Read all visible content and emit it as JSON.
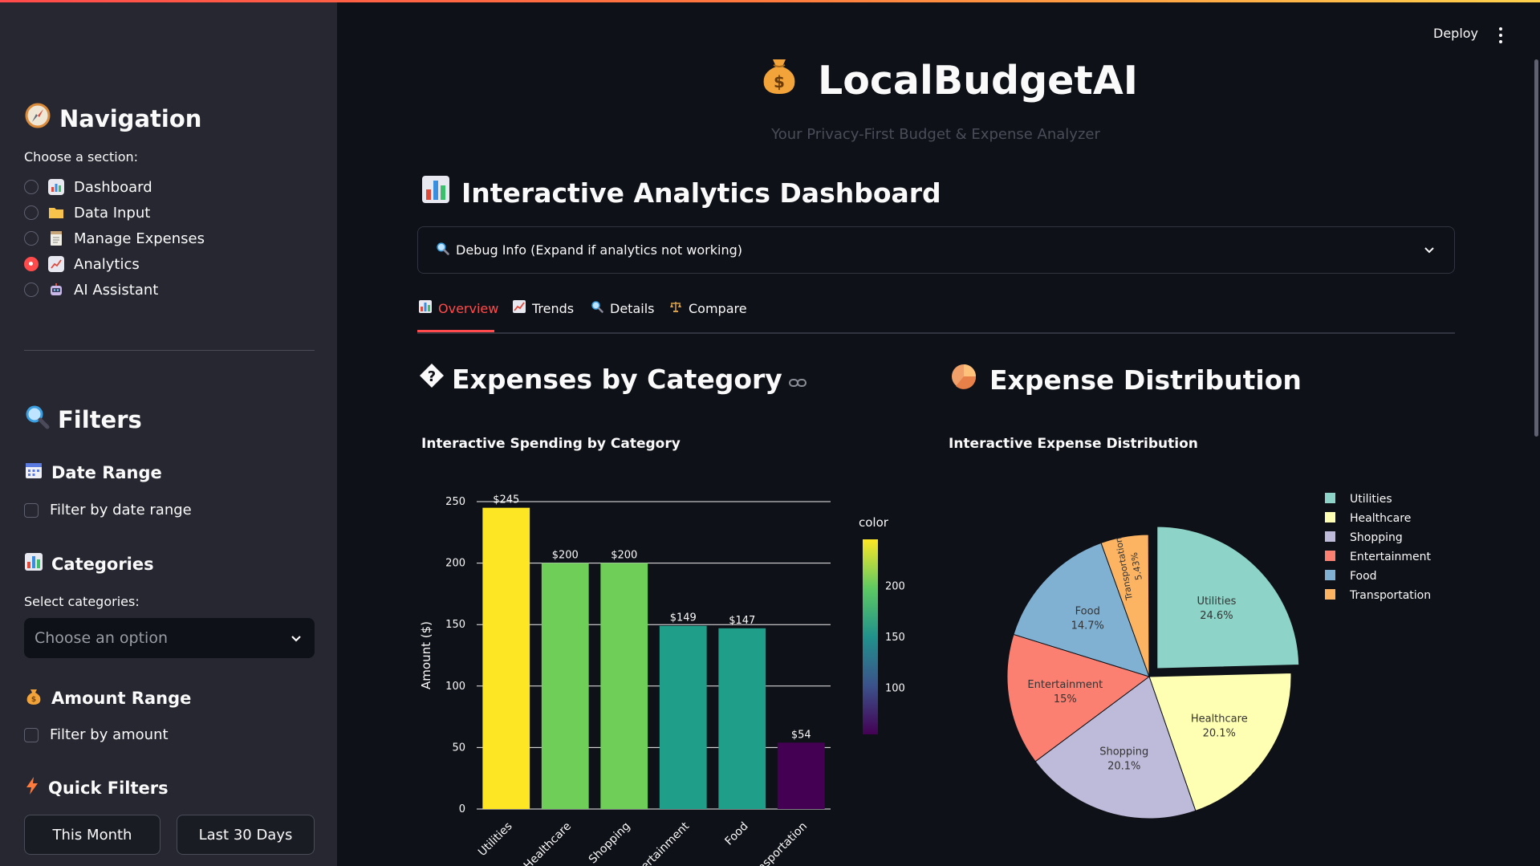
{
  "app": {
    "title": "LocalBudgetAI",
    "subtitle": "Your Privacy-First Budget & Expense Analyzer",
    "deploy_label": "Deploy"
  },
  "sidebar": {
    "navigation_title": "Navigation",
    "choose_label": "Choose a section:",
    "nav_items": [
      {
        "label": "Dashboard",
        "selected": false,
        "icon": "bar-chart-icon"
      },
      {
        "label": "Data Input",
        "selected": false,
        "icon": "folder-icon"
      },
      {
        "label": "Manage Expenses",
        "selected": false,
        "icon": "notepad-icon"
      },
      {
        "label": "Analytics",
        "selected": true,
        "icon": "trend-chart-icon"
      },
      {
        "label": "AI Assistant",
        "selected": false,
        "icon": "robot-icon"
      }
    ],
    "filters_title": "Filters",
    "date_range_title": "Date Range",
    "date_range_checkbox": "Filter by date range",
    "categories_title": "Categories",
    "select_categories_label": "Select categories:",
    "categories_placeholder": "Choose an option",
    "amount_range_title": "Amount Range",
    "amount_checkbox": "Filter by amount",
    "quick_filters_title": "Quick Filters",
    "quick_buttons": [
      "This Month",
      "Last 30 Days"
    ]
  },
  "main": {
    "dashboard_title": "Interactive Analytics Dashboard",
    "debug_expander": "Debug Info (Expand if analytics not working)",
    "tabs": [
      {
        "label": "Overview",
        "active": true
      },
      {
        "label": "Trends",
        "active": false
      },
      {
        "label": "Details",
        "active": false
      },
      {
        "label": "Compare",
        "active": false
      }
    ],
    "section_left": "Expenses by Category",
    "section_right": "Expense Distribution"
  },
  "chart_data": [
    {
      "type": "bar",
      "title": "Interactive Spending by Category",
      "ylabel": "Amount ($)",
      "xlabel": "",
      "categories": [
        "Utilities",
        "Healthcare",
        "Shopping",
        "Entertainment",
        "Food",
        "Transportation"
      ],
      "values": [
        245,
        200,
        200,
        149,
        147,
        54
      ],
      "data_labels": [
        "$245",
        "$200",
        "$200",
        "$149",
        "$147",
        "$54"
      ],
      "colors": [
        "#fde725",
        "#6ece58",
        "#6ece58",
        "#1f9e89",
        "#1f9e89",
        "#440154"
      ],
      "ylim": [
        0,
        250
      ],
      "yticks": [
        0,
        50,
        100,
        150,
        200,
        250
      ],
      "colorbar": {
        "title": "color",
        "ticks": [
          100,
          150,
          200
        ],
        "range": [
          54,
          245
        ],
        "colorscale": "viridis"
      },
      "grid": true
    },
    {
      "type": "pie",
      "title": "Interactive Expense Distribution",
      "slices": [
        {
          "label": "Utilities",
          "percent": 24.6,
          "text": "24.6%",
          "color": "#8dd3c7",
          "pulled": true
        },
        {
          "label": "Healthcare",
          "percent": 20.1,
          "text": "20.1%",
          "color": "#ffffb3",
          "pulled": false
        },
        {
          "label": "Shopping",
          "percent": 20.1,
          "text": "20.1%",
          "color": "#bebada",
          "pulled": false
        },
        {
          "label": "Entertainment",
          "percent": 15.0,
          "text": "15%",
          "color": "#fb8072",
          "pulled": false
        },
        {
          "label": "Food",
          "percent": 14.7,
          "text": "14.7%",
          "color": "#80b1d3",
          "pulled": false
        },
        {
          "label": "Transportation",
          "percent": 5.43,
          "text": "5.43%",
          "color": "#fdb462",
          "pulled": false
        }
      ],
      "legend_placement": "right"
    }
  ]
}
